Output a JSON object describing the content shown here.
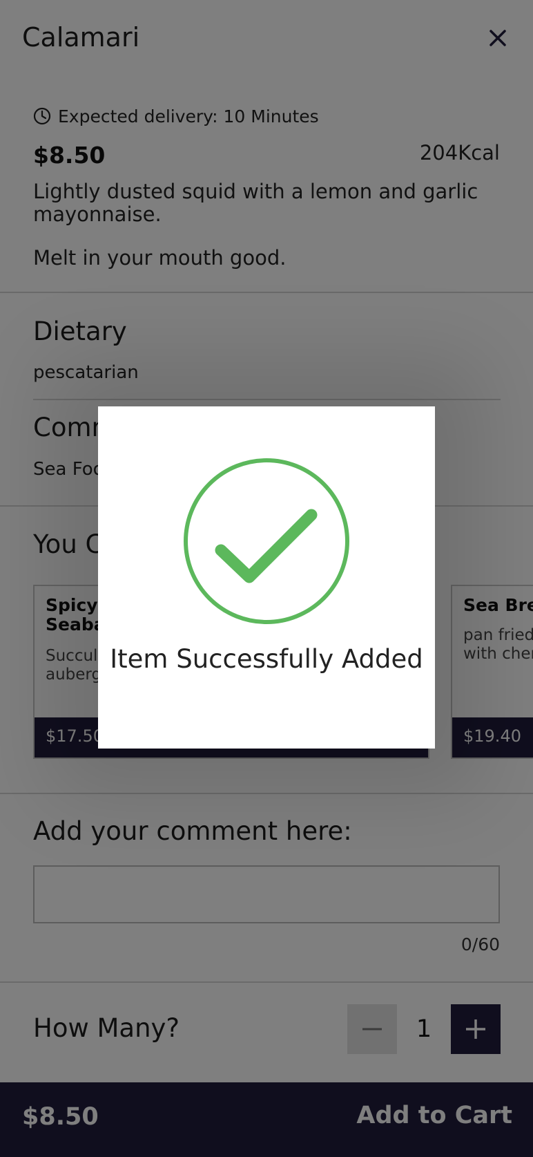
{
  "header": {
    "title": "Calamari",
    "close_icon": "close-icon"
  },
  "item": {
    "delivery": "Expected delivery: 10 Minutes",
    "delivery_icon": "clock-icon",
    "price": "$8.50",
    "kcal": "204Kcal",
    "description": "Lightly dusted squid with a lemon and garlic mayonnaise.",
    "tagline": "Melt in your mouth good."
  },
  "dietary": {
    "heading": "Dietary",
    "value": "pescatarian"
  },
  "comments": {
    "heading": "Comm",
    "value": "Sea Foo"
  },
  "recommendations": {
    "heading": "You C",
    "cards": [
      {
        "name": "Spicy\nSeaba",
        "description": "Succul\nauberg",
        "price": "$17.50"
      },
      {
        "name": "Sea Brea",
        "description": "pan fried\nwith cher",
        "price": "$19.40"
      }
    ]
  },
  "comment_input": {
    "label": "Add your comment here:",
    "value": "",
    "counter": "0/60"
  },
  "quantity": {
    "label": "How Many?",
    "value": "1",
    "minus_icon": "minus-icon",
    "plus_icon": "plus-icon"
  },
  "bottom_bar": {
    "price": "$8.50",
    "add_label": "Add to Cart"
  },
  "modal": {
    "message": "Item Successfully Added",
    "icon": "check-circle-icon",
    "accent": "#5cb85c"
  },
  "colors": {
    "brand_dark": "#211c3d",
    "overlay": "rgba(0,0,0,0.5)"
  }
}
